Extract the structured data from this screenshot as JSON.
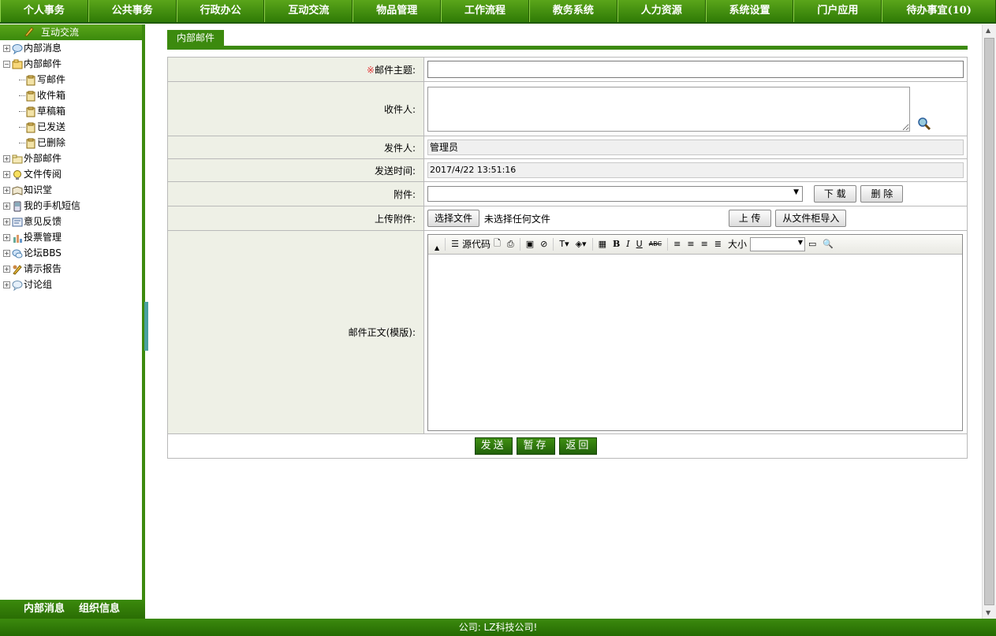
{
  "topnav": [
    "个人事务",
    "公共事务",
    "行政办公",
    "互动交流",
    "物品管理",
    "工作流程",
    "教务系统",
    "人力资源",
    "系统设置",
    "门户应用",
    "待办事宜(10)"
  ],
  "sidebar": {
    "title": "互动交流",
    "tree": [
      {
        "label": "内部消息",
        "icon": "chat-bubble-icon",
        "level": 0,
        "expander": "+"
      },
      {
        "label": "内部邮件",
        "icon": "folder-open-icon",
        "level": 0,
        "expander": "-"
      },
      {
        "label": "写邮件",
        "icon": "clipboard-icon",
        "level": 1
      },
      {
        "label": "收件箱",
        "icon": "clipboard-icon",
        "level": 1
      },
      {
        "label": "草稿箱",
        "icon": "clipboard-icon",
        "level": 1
      },
      {
        "label": "已发送",
        "icon": "clipboard-icon",
        "level": 1
      },
      {
        "label": "已删除",
        "icon": "clipboard-icon",
        "level": 1
      },
      {
        "label": "外部邮件",
        "icon": "folder-icon",
        "level": 0,
        "expander": "+"
      },
      {
        "label": "文件传阅",
        "icon": "lightbulb-icon",
        "level": 0,
        "expander": "+"
      },
      {
        "label": "知识堂",
        "icon": "book-icon",
        "level": 0,
        "expander": "+"
      },
      {
        "label": "我的手机短信",
        "icon": "phone-icon",
        "level": 0,
        "expander": "+"
      },
      {
        "label": "意见反馈",
        "icon": "feedback-icon",
        "level": 0,
        "expander": "+"
      },
      {
        "label": "投票管理",
        "icon": "vote-icon",
        "level": 0,
        "expander": "+"
      },
      {
        "label": "论坛BBS",
        "icon": "forum-icon",
        "level": 0,
        "expander": "+"
      },
      {
        "label": "请示报告",
        "icon": "report-icon",
        "level": 0,
        "expander": "+"
      },
      {
        "label": "讨论组",
        "icon": "discussion-icon",
        "level": 0,
        "expander": "+"
      }
    ],
    "footer": [
      "内部消息",
      "组织信息"
    ]
  },
  "main": {
    "tab": "内部邮件",
    "form": {
      "subject_label": "邮件主题:",
      "required_mark": "※",
      "recipient_label": "收件人:",
      "sender_label": "发件人:",
      "sender_value": "管理员",
      "send_time_label": "发送时间:",
      "send_time_value": "2017/4/22 13:51:16",
      "attachment_label": "附件:",
      "download_label": "下 载",
      "delete_label": "删 除",
      "upload_label": "上传附件:",
      "choose_file_label": "选择文件",
      "no_file_text": "未选择任何文件",
      "upload_button": "上 传",
      "import_button": "从文件柜导入",
      "body_label": "邮件正文(模版):",
      "toolbar_source": "源代码",
      "toolbar_size": "大小"
    },
    "actions": {
      "send": "发送",
      "save": "暂存",
      "back": "返回"
    }
  },
  "footer": "公司: LZ科技公司!"
}
